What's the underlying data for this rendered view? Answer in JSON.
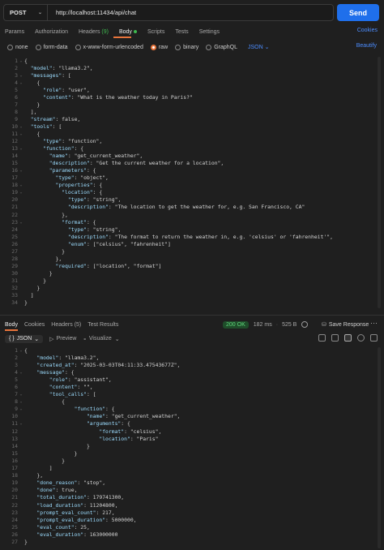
{
  "request": {
    "method": "POST",
    "url": "http://localhost:11434/api/chat",
    "send_label": "Send"
  },
  "tabs": [
    {
      "label": "Params"
    },
    {
      "label": "Authorization"
    },
    {
      "label": "Headers",
      "count": "(9)"
    },
    {
      "label": "Body"
    },
    {
      "label": "Scripts"
    },
    {
      "label": "Tests"
    },
    {
      "label": "Settings"
    }
  ],
  "cookies_label": "Cookies",
  "body_types": [
    "none",
    "form-data",
    "x-www-form-urlencoded",
    "raw",
    "binary",
    "GraphQL"
  ],
  "body_format": "JSON",
  "beautify_label": "Beautify",
  "request_lines": [
    "{",
    "  \"model\": \"llama3.2\",",
    "  \"messages\": [",
    "    {",
    "      \"role\": \"user\",",
    "      \"content\": \"What is the weather today in Paris?\"",
    "    }",
    "  ],",
    "  \"stream\": false,",
    "  \"tools\": [",
    "    {",
    "      \"type\": \"function\",",
    "      \"function\": {",
    "        \"name\": \"get_current_weather\",",
    "        \"description\": \"Get the current weather for a location\",",
    "        \"parameters\": {",
    "          \"type\": \"object\",",
    "          \"properties\": {",
    "            \"location\": {",
    "              \"type\": \"string\",",
    "              \"description\": \"The location to get the weather for, e.g. San Francisco, CA\"",
    "            },",
    "            \"format\": {",
    "              \"type\": \"string\",",
    "              \"description\": \"The format to return the weather in, e.g. 'celsius' or 'fahrenheit'\",",
    "              \"enum\": [\"celsius\", \"fahrenheit\"]",
    "            }",
    "          },",
    "          \"required\": [\"location\", \"format\"]",
    "        }",
    "      }",
    "    }",
    "  ]",
    "}"
  ],
  "response_tabs": [
    {
      "label": "Body"
    },
    {
      "label": "Cookies"
    },
    {
      "label": "Headers",
      "count": "(5)"
    },
    {
      "label": "Test Results"
    }
  ],
  "status": {
    "code": "200 OK",
    "time": "182 ms",
    "size": "525 B"
  },
  "save_response_label": "Save Response",
  "response_format": "JSON",
  "preview_label": "Preview",
  "visualize_label": "Visualize",
  "response_lines": [
    "{",
    "    \"model\": \"llama3.2\",",
    "    \"created_at\": \"2025-03-03T04:11:33.47543677Z\",",
    "    \"message\": {",
    "        \"role\": \"assistant\",",
    "        \"content\": \"\",",
    "        \"tool_calls\": [",
    "            {",
    "                \"function\": {",
    "                    \"name\": \"get_current_weather\",",
    "                    \"arguments\": {",
    "                        \"format\": \"celsius\",",
    "                        \"location\": \"Paris\"",
    "                    }",
    "                }",
    "            }",
    "        ]",
    "    },",
    "    \"done_reason\": \"stop\",",
    "    \"done\": true,",
    "    \"total_duration\": 179741300,",
    "    \"load_duration\": 11204800,",
    "    \"prompt_eval_count\": 217,",
    "    \"prompt_eval_duration\": 5000000,",
    "    \"eval_count\": 25,",
    "    \"eval_duration\": 163000000",
    "}"
  ]
}
